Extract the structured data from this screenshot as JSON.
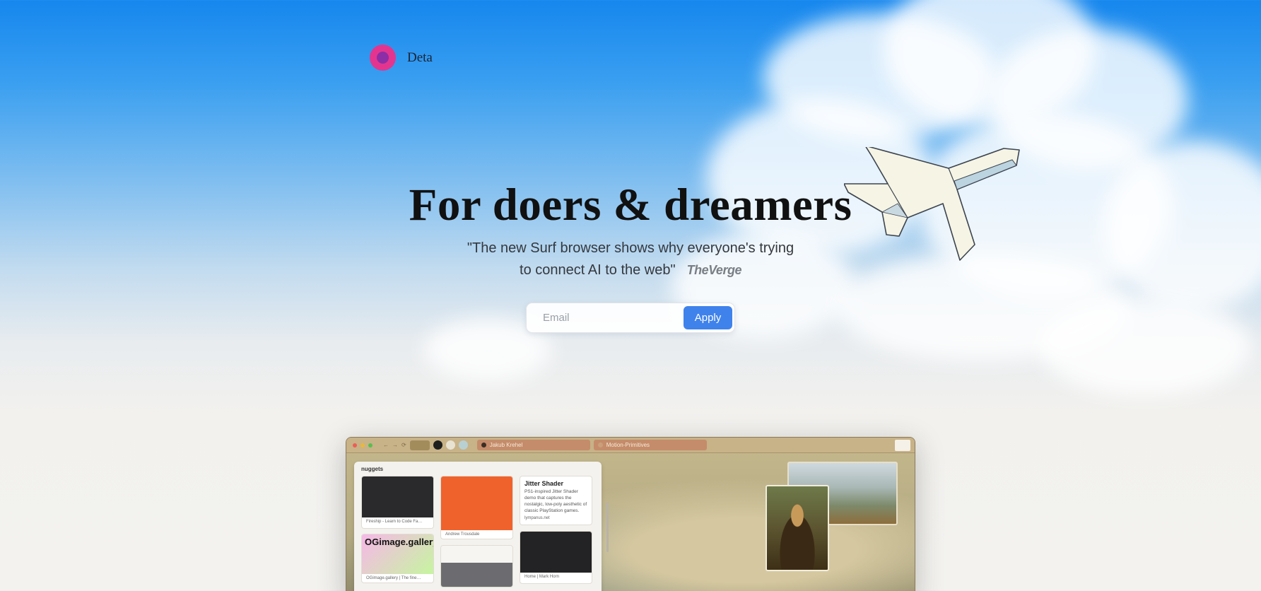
{
  "brand": {
    "name": "Deta"
  },
  "hero": {
    "title": "For doers & dreamers",
    "quote_line1": "\"The new Surf browser shows why everyone's trying",
    "quote_line2": "to connect AI to the web\"",
    "source": "TheVerge"
  },
  "signup": {
    "placeholder": "Email",
    "button": "Apply"
  },
  "colors": {
    "accent": "#3f82ec",
    "logo_outer": "#e3358f",
    "logo_inner": "#8c2ea6"
  },
  "browser": {
    "tabs": [
      "Jakub Krehel",
      "Motion-Primitives"
    ],
    "panel_title": "nuggets",
    "cards": {
      "firestip": "Fireship - Learn to Code Fa…",
      "andrew": "Andrew Trousdale",
      "jitter_title": "Jitter Shader",
      "jitter_body": "PS1-inspired Jitter Shader demo that captures the nostalgic, low-poly aesthetic of classic PlayStation games.",
      "jitter_site": "lympanus.net",
      "og_title": "OGimage.gallery",
      "og_caption": "OGimage.gallery | The fine…",
      "home": "Home | Mark Horn"
    }
  }
}
